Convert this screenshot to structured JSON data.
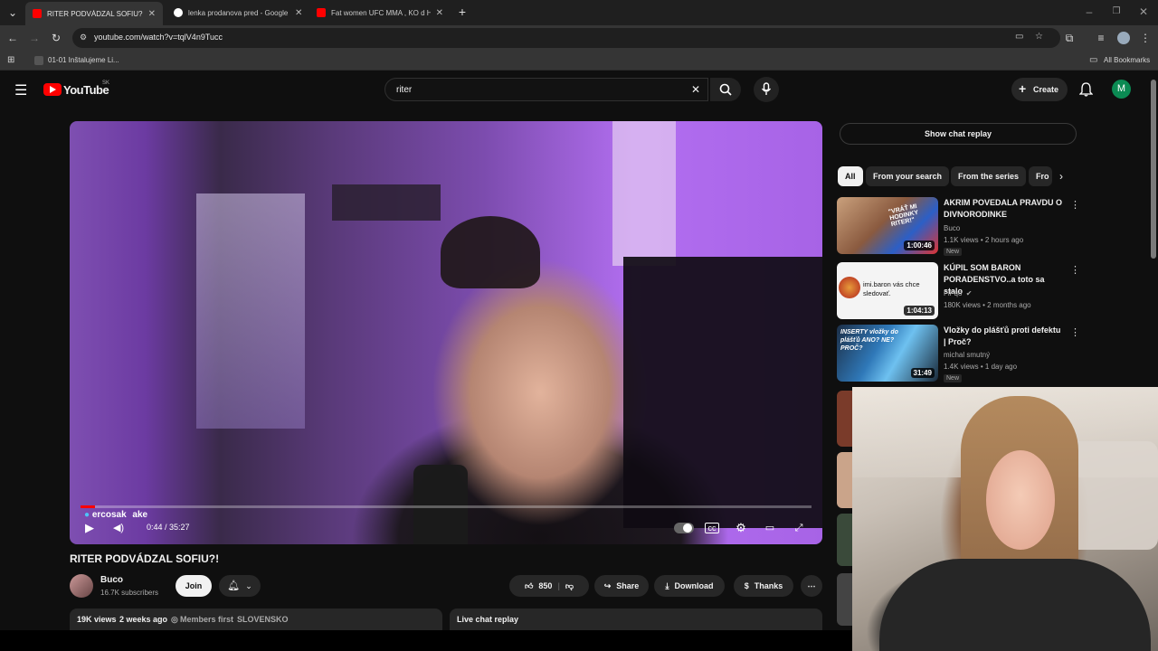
{
  "browser": {
    "tabs": [
      {
        "title": "RITER PODVÁDZAL SOFIU?! - Yo",
        "icon": "youtube-icon",
        "active": true
      },
      {
        "title": "lenka prodanova pred - Google",
        "icon": "google-icon",
        "active": false
      },
      {
        "title": "Fat women UFC MMA , KO d Ha",
        "icon": "youtube-icon",
        "active": false
      }
    ],
    "url": "youtube.com/watch?v=tqlV4n9Tucc",
    "bookmark": "01-01 Inštalujeme Li...",
    "bookmarks_all": "All Bookmarks"
  },
  "youtube": {
    "logo_text": "YouTube",
    "region": "SK",
    "search_value": "riter",
    "create_label": "Create",
    "avatar_letter": "M"
  },
  "player": {
    "overlay_name": "ercosak",
    "overlay_suffix": "ake",
    "time": "0:44 / 35:27",
    "progress": 0.02
  },
  "video": {
    "title": "RITER PODVÁDZAL SOFIU?!",
    "channel": "Buco",
    "subscribers": "16.7K subscribers",
    "join_label": "Join",
    "likes": "850",
    "share_label": "Share",
    "download_label": "Download",
    "thanks_label": "Thanks",
    "views": "19K views",
    "age": "2 weeks ago",
    "members": "Members first",
    "country": "SLOVENSKO",
    "live_chat_replay": "Live chat replay"
  },
  "sidebar": {
    "show_chat": "Show chat replay",
    "chips": [
      "All",
      "From your search",
      "From the series",
      "Fro"
    ],
    "recs": [
      {
        "title": "AKRIM POVEDALA PRAVDU O DIVNORODINKE",
        "channel": "Buco",
        "meta": "1.1K views • 2 hours ago",
        "badge": "New",
        "duration": "1:00:46",
        "thumb_text": "\"VRÁŤ MI HODINKY RITER!\""
      },
      {
        "title": "KÚPIL SOM BARON PORADENSTVO..a toto sa stalo",
        "channel": "FiFqo",
        "meta": "180K views • 2 months ago",
        "badge": "",
        "duration": "1:04:13",
        "thumb_text": "imi.baron vás chce sledovať."
      },
      {
        "title": "Vložky do plášťů proti defektu | Proč?",
        "channel": "michal smutný",
        "meta": "1.4K views • 1 day ago",
        "badge": "New",
        "duration": "31:49",
        "thumb_text": "INSERTY vložky do plášťů ANO? NE? PROČ?"
      }
    ]
  },
  "colors": {
    "brand_red": "#ff0000",
    "background": "#0f0f0f",
    "chip_active": "#f1f1f1"
  }
}
